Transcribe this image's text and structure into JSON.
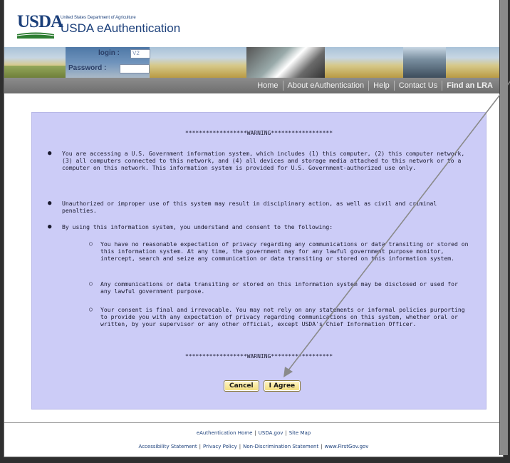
{
  "header": {
    "logo": "USDA",
    "agency": "United States Department of Agriculture",
    "title": "USDA eAuthentication"
  },
  "banner": {
    "login_label": "login :",
    "login_value": "V2",
    "password_label": "Password :"
  },
  "nav": {
    "items": [
      "Home",
      "About eAuthentication",
      "Help",
      "Contact Us",
      "Find an LRA"
    ]
  },
  "warning": {
    "header_top": "******************WARNING******************",
    "header_bottom": "******************WARNING******************",
    "bullets": [
      "You are accessing a U.S. Government information system, which includes (1) this computer, (2) this computer network, (3) all computers connected to this network, and (4) all devices and storage media attached to this network or to a computer on this network. This information system is provided for U.S. Government-authorized use only.",
      "Unauthorized or improper use of this system may result in disciplinary action, as well as civil and criminal penalties.",
      "By using this information system, you understand and consent to the following:"
    ],
    "sub_bullets": [
      "You have no reasonable expectation of privacy regarding any communications or data transiting or stored on this information system. At any time, the government may for any lawful government purpose monitor, intercept, search and seize any communication or data transiting or stored on this information system.",
      "Any communications or data transiting or stored on this information system may be disclosed or used for any lawful government purpose.",
      "Your consent is final and irrevocable. You may not rely on any statements or informal policies purporting to provide you with any expectation of privacy regarding communications on this system, whether oral or written, by your supervisor or any other official, except USDA's Chief Information Officer."
    ],
    "cancel_label": "Cancel",
    "agree_label": "I Agree"
  },
  "footer": {
    "row1": [
      "eAuthentication Home",
      "USDA.gov",
      "Site Map"
    ],
    "row2": [
      "Accessibility Statement",
      "Privacy Policy",
      "Non-Discrimination Statement",
      "www.FirstGov.gov"
    ],
    "separator": "|"
  },
  "colors": {
    "brand_blue": "#1b3f7a",
    "nav_gray": "#7d7d7d",
    "warning_bg": "#ccccf7",
    "button_yellow": "#f2dc7a"
  }
}
